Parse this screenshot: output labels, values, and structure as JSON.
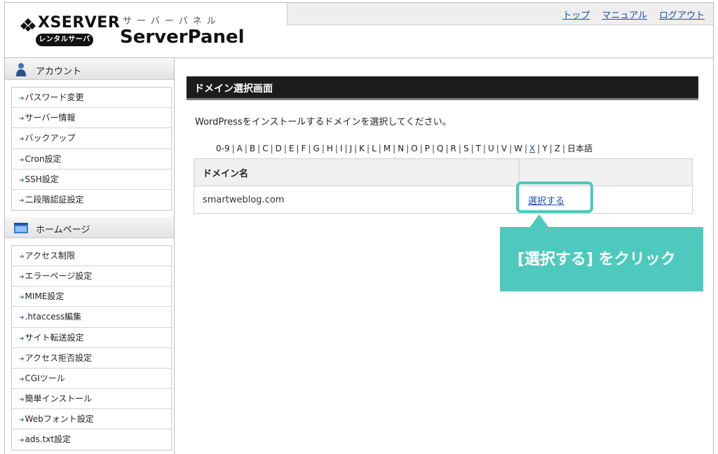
{
  "header": {
    "brand": "XSERVER",
    "brand_sub": "レンタルサーバー",
    "panel_kana": "サーバーパネル",
    "panel_title": "ServerPanel",
    "links": [
      "トップ",
      "マニュアル",
      "ログアウト"
    ]
  },
  "sidebar": {
    "account": {
      "title": "アカウント",
      "items": [
        "パスワード変更",
        "サーバー情報",
        "バックアップ",
        "Cron設定",
        "SSH設定",
        "二段階認証設定"
      ]
    },
    "homepage": {
      "title": "ホームページ",
      "items": [
        "アクセス制限",
        "エラーページ設定",
        "MIME設定",
        ".htaccess編集",
        "サイト転送設定",
        "アクセス拒否設定",
        "CGIツール",
        "簡単インストール",
        "Webフォント設定",
        "ads.txt設定"
      ]
    }
  },
  "main": {
    "page_title": "ドメイン選択画面",
    "instruction": "WordPressをインストールするドメインを選択してください。",
    "alpha_nav": [
      "0-9",
      "A",
      "B",
      "C",
      "D",
      "E",
      "F",
      "G",
      "H",
      "I",
      "J",
      "K",
      "L",
      "M",
      "N",
      "O",
      "P",
      "Q",
      "R",
      "S",
      "T",
      "U",
      "V",
      "W",
      "X",
      "Y",
      "Z",
      "日本語"
    ],
    "alpha_nav_linked": "X",
    "table": {
      "header_domain": "ドメイン名",
      "header_action": "",
      "rows": [
        {
          "domain": "smartweblog.com",
          "action": "選択する"
        }
      ]
    }
  },
  "callout": {
    "text": "[選択する] をクリック",
    "color": "#4ec9bd"
  },
  "colors": {
    "link": "#1a4fa8",
    "page_head_bg": "#1c1c1c",
    "accent": "#4ec9bd"
  }
}
